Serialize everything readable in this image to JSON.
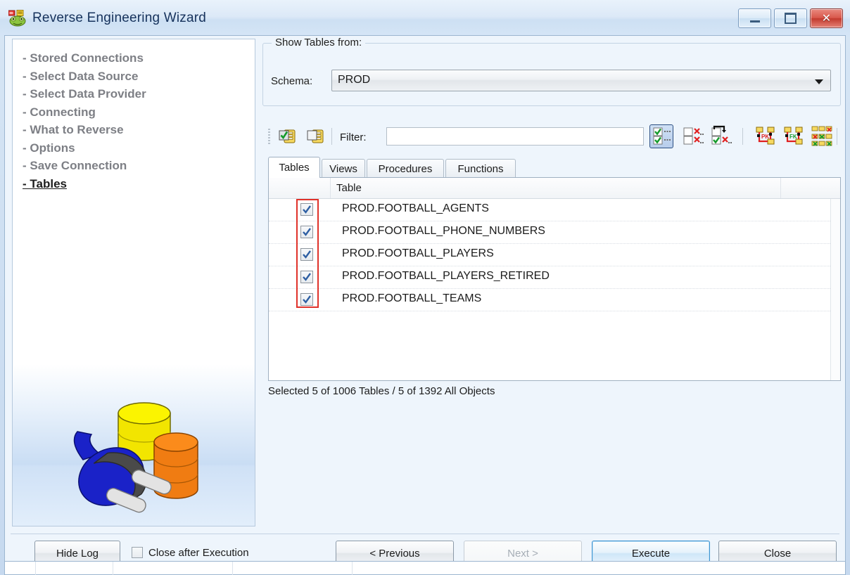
{
  "window": {
    "title": "Reverse Engineering Wizard",
    "icon": "reverse-engineering-icon",
    "minimize_label": "",
    "maximize_label": "",
    "close_label": "✕"
  },
  "sidebar": {
    "steps": [
      {
        "label": "- Stored Connections",
        "current": false
      },
      {
        "label": "- Select Data Source",
        "current": false
      },
      {
        "label": "- Select Data Provider",
        "current": false
      },
      {
        "label": "- Connecting",
        "current": false
      },
      {
        "label": "- What to Reverse",
        "current": false
      },
      {
        "label": "- Options",
        "current": false
      },
      {
        "label": "- Save Connection",
        "current": false
      },
      {
        "label": "- Tables",
        "current": true
      }
    ],
    "illustration": "database-plug-illustration"
  },
  "show_tables_group": {
    "legend": "Show Tables from:",
    "schema_label": "Schema:",
    "schema_value": "PROD",
    "schema_options": [
      "PROD"
    ]
  },
  "toolbar": {
    "filter_label": "Filter:",
    "filter_value": "",
    "filter_placeholder": "",
    "buttons": [
      {
        "name": "select-all-icon",
        "title": "Select All"
      },
      {
        "name": "deselect-all-icon",
        "title": "Deselect All"
      },
      {
        "name": "show-selected-icon",
        "title": "Show Selected",
        "selected": true
      },
      {
        "name": "hide-unselected-icon",
        "title": "Hide Unselected"
      },
      {
        "name": "move-selected-icon",
        "title": "Move Selected"
      },
      {
        "name": "select-pk-icon",
        "title": "Select Primary Keys"
      },
      {
        "name": "select-fk-icon",
        "title": "Select Foreign Keys"
      },
      {
        "name": "select-all-keys-icon",
        "title": "Select All Keys"
      }
    ]
  },
  "tabs": [
    {
      "label": "Tables",
      "active": true
    },
    {
      "label": "Views",
      "active": false
    },
    {
      "label": "Procedures",
      "active": false
    },
    {
      "label": "Functions",
      "active": false
    }
  ],
  "table_list": {
    "columns": [
      "",
      "Table",
      ""
    ],
    "rows": [
      {
        "checked": true,
        "name": "PROD.FOOTBALL_AGENTS"
      },
      {
        "checked": true,
        "name": "PROD.FOOTBALL_PHONE_NUMBERS"
      },
      {
        "checked": true,
        "name": "PROD.FOOTBALL_PLAYERS"
      },
      {
        "checked": true,
        "name": "PROD.FOOTBALL_PLAYERS_RETIRED"
      },
      {
        "checked": true,
        "name": "PROD.FOOTBALL_TEAMS"
      }
    ]
  },
  "status": {
    "text": "Selected 5 of 1006 Tables / 5 of 1392 All Objects"
  },
  "footer": {
    "hide_log_label": "Hide Log",
    "close_after_execution_label": "Close after Execution",
    "close_after_execution_checked": false,
    "previous_label": "< Previous",
    "next_label": "Next >",
    "next_disabled": true,
    "execute_label": "Execute",
    "execute_default": true,
    "close_label": "Close"
  },
  "annotations": {
    "arrow": "red-up-arrow",
    "highlight_box": "red-highlight-box"
  },
  "colors": {
    "accent_blue": "#3c93d0",
    "annotation_red": "#e0322a",
    "current_step": "#1d1d1d",
    "step_grey": "#7d7f85"
  }
}
